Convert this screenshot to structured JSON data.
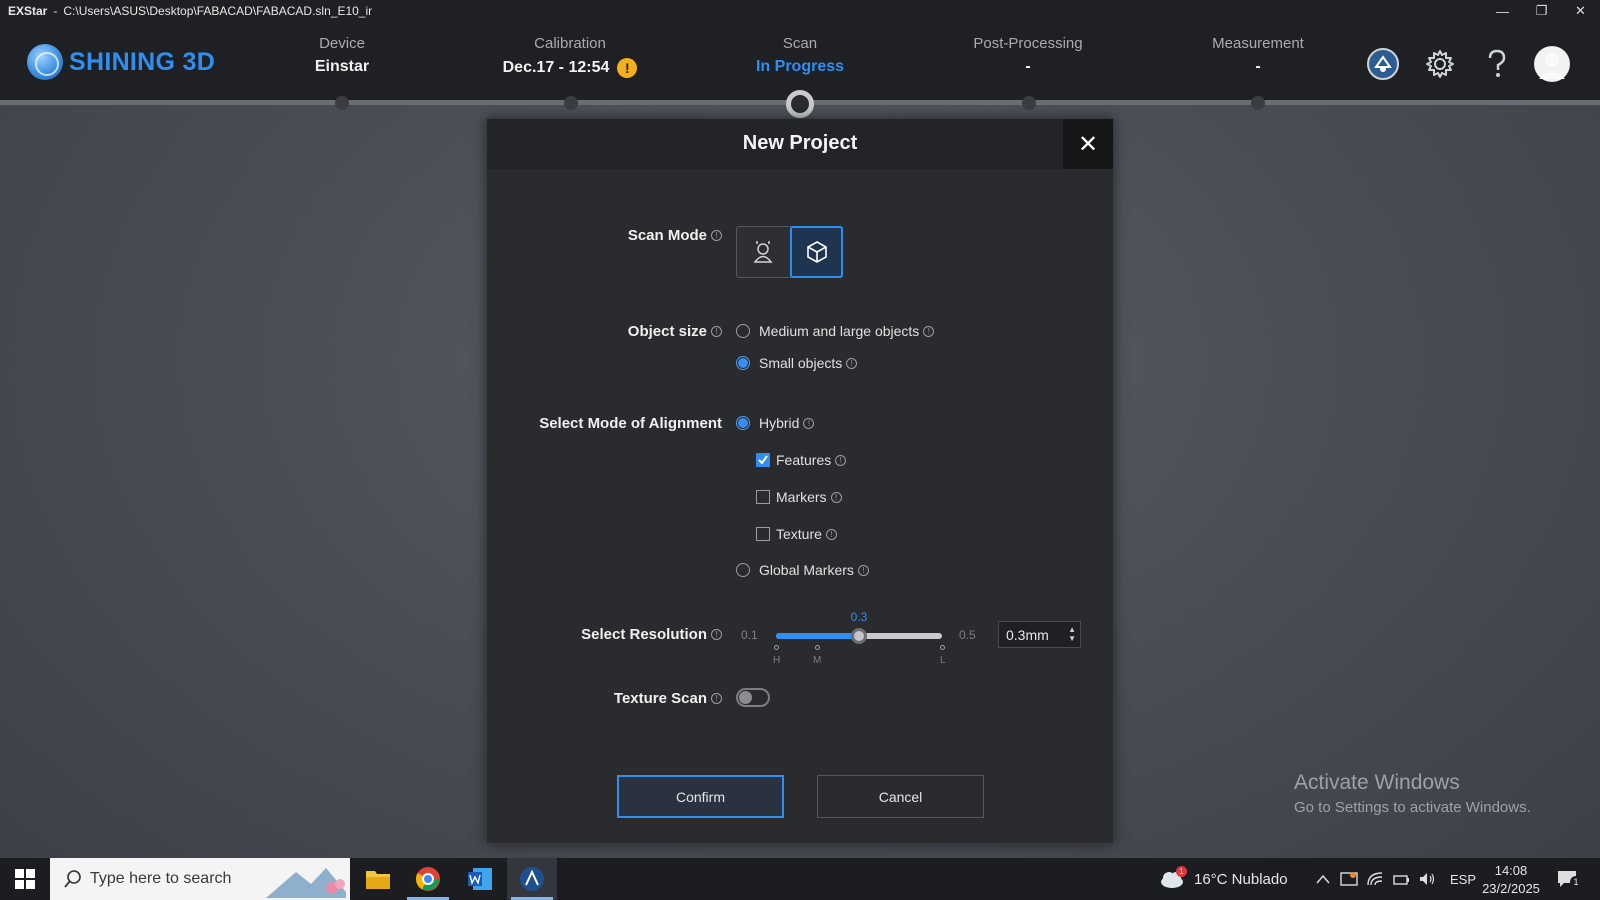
{
  "titlebar": {
    "app_name": "EXStar",
    "separator": "-",
    "path": "C:\\Users\\ASUS\\Desktop\\FABACAD\\FABACAD.sln_E10_ir"
  },
  "header": {
    "brand": "SHINING 3D",
    "steps": [
      {
        "label": "Device",
        "value": "Einstar"
      },
      {
        "label": "Calibration",
        "value": "Dec.17 - 12:54",
        "warning": "!"
      },
      {
        "label": "Scan",
        "value": "In Progress",
        "active": true
      },
      {
        "label": "Post-Processing",
        "value": "-"
      },
      {
        "label": "Measurement",
        "value": "-"
      }
    ],
    "accent_color": "#2f8ff0"
  },
  "modal": {
    "title": "New Project",
    "close": "✕",
    "info_glyph": "!",
    "scan_mode": {
      "label": "Scan Mode",
      "options": [
        "portrait-icon",
        "cube-icon"
      ],
      "selected": "cube-icon"
    },
    "object_size": {
      "label": "Object size",
      "options": [
        {
          "label": "Medium and large objects",
          "selected": false
        },
        {
          "label": "Small objects",
          "selected": true
        }
      ]
    },
    "alignment": {
      "label": "Select Mode of Alignment",
      "hybrid": "Hybrid",
      "features": "Features",
      "markers": "Markers",
      "texture": "Texture",
      "global_markers": "Global Markers",
      "selected": "Hybrid",
      "checked": [
        "Features"
      ]
    },
    "resolution": {
      "label": "Select Resolution",
      "min": "0.1",
      "max": "0.5",
      "current": "0.3",
      "value": 0.3,
      "ticks": [
        "H",
        "M",
        "L"
      ],
      "field": "0.3mm"
    },
    "texture_scan": {
      "label": "Texture Scan",
      "enabled": false
    },
    "confirm": "Confirm",
    "cancel": "Cancel"
  },
  "watermark": {
    "line1": "Activate Windows",
    "line2": "Go to Settings to activate Windows."
  },
  "taskbar": {
    "search_placeholder": "Type here to search",
    "weather": "16°C  Nublado",
    "weather_badge": "1",
    "language": "ESP",
    "time": "14:08",
    "date": "23/2/2025",
    "notification_count": "1"
  }
}
